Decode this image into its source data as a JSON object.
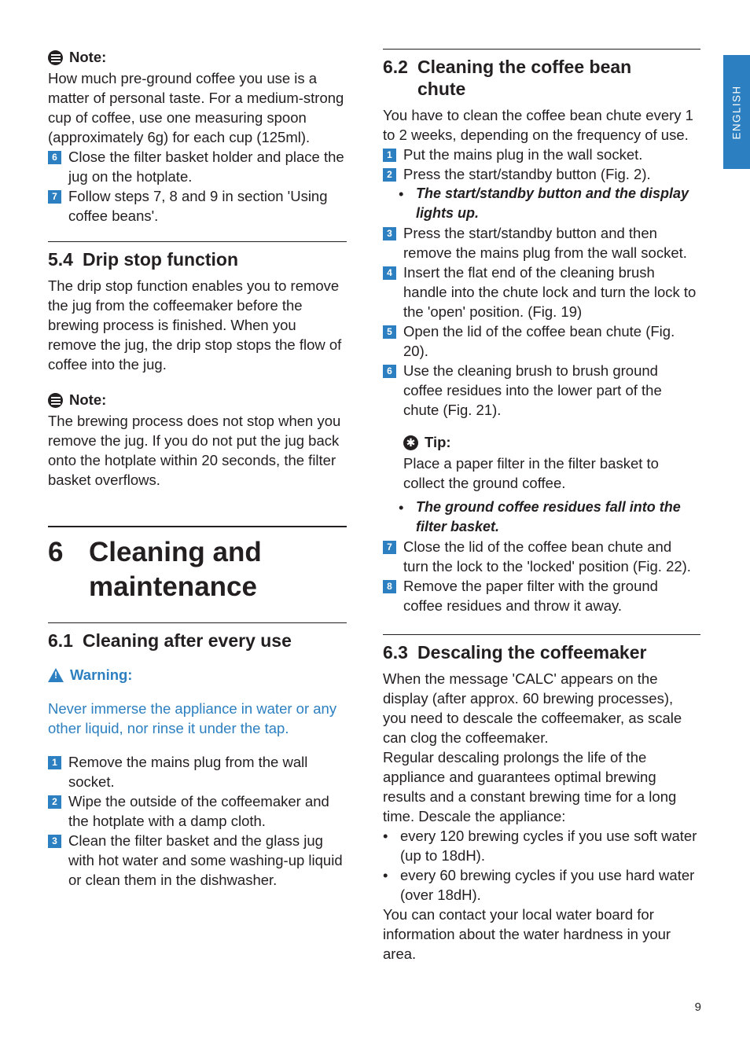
{
  "side_tab": {
    "label": "ENGLISH"
  },
  "page_number": "9",
  "left_column": {
    "note1": {
      "icon": "note-icon",
      "label": "Note:",
      "text": "How much pre-ground coffee you use is a matter of personal taste. For a medium-strong cup of coffee, use one measuring spoon (approximately 6g) for each cup (125ml)."
    },
    "steps_continued": [
      {
        "num": "6",
        "text": "Close the filter basket holder and place the jug on the hotplate."
      },
      {
        "num": "7",
        "text": "Follow steps 7, 8 and 9 in section 'Using coffee beans'."
      }
    ],
    "section_5_4": {
      "number": "5.4",
      "title": "Drip stop function",
      "body": "The drip stop function enables you to remove the jug from the coffeemaker before the brewing process is finished. When you remove the jug, the drip stop stops the flow of coffee into the jug."
    },
    "note2": {
      "icon": "note-icon",
      "label": "Note:",
      "text": "The brewing process does not stop when you remove the jug. If you do not put the jug back onto the hotplate within 20 seconds, the filter basket overflows."
    },
    "chapter_6": {
      "number": "6",
      "title_line1": "Cleaning and",
      "title_line2": "maintenance"
    },
    "section_6_1": {
      "number": "6.1",
      "title": "Cleaning after every use",
      "warning": {
        "icon": "warning-icon",
        "label": "Warning:",
        "text": "Never immerse the appliance in water or any other liquid, nor rinse it under the tap."
      },
      "steps": [
        {
          "num": "1",
          "text": "Remove the mains plug from the wall socket."
        },
        {
          "num": "2",
          "text": "Wipe the outside of the coffeemaker and the hotplate with a damp cloth."
        },
        {
          "num": "3",
          "text": " Clean the filter basket and the glass jug with hot water and some washing-up liquid or clean them in the dishwasher."
        }
      ]
    }
  },
  "right_column": {
    "section_6_2": {
      "number": "6.2",
      "title_line1": "Cleaning the coffee bean",
      "title_line2": "chute",
      "body": "You have to clean the coffee bean chute every 1 to 2 weeks, depending on the frequency of use.",
      "steps_a": [
        {
          "num": "1",
          "text": "Put the mains plug in the wall socket."
        },
        {
          "num": "2",
          "text": "Press the start/standby button (Fig. 2)."
        }
      ],
      "result_1": "The start/standby button and the display lights up.",
      "steps_b": [
        {
          "num": "3",
          "text": "Press the start/standby button and then remove the mains plug from the wall socket."
        },
        {
          "num": "4",
          "text": "Insert the flat end of the cleaning brush handle into the chute lock and turn the lock to the 'open' position.  (Fig. 19)"
        },
        {
          "num": "5",
          "text": "Open the lid of the coffee bean chute (Fig. 20)."
        },
        {
          "num": "6",
          "text": "Use the cleaning brush to brush ground coffee residues into the lower part of the chute (Fig. 21)."
        }
      ],
      "tip": {
        "icon": "tip-icon",
        "label": "Tip:",
        "text": "Place a paper filter in the filter basket to collect the ground coffee."
      },
      "result_2": "The ground coffee residues fall into the filter basket.",
      "steps_c": [
        {
          "num": "7",
          "text": "Close the lid of the coffee bean chute and turn the lock to the 'locked' position (Fig. 22)."
        },
        {
          "num": "8",
          "text": "Remove the paper filter with the ground coffee residues and throw it away."
        }
      ]
    },
    "section_6_3": {
      "number": "6.3",
      "title": "Descaling the coffeemaker",
      "para1": "When the message 'CALC' appears on the display (after approx. 60 brewing processes), you need to descale the coffeemaker, as scale can clog the coffeemaker.",
      "para2": "Regular descaling prolongs the life of the appliance and guarantees optimal brewing results and a constant brewing time for a long time. Descale the appliance:",
      "bullets": [
        "every 120 brewing cycles if you use soft water (up to 18dH).",
        "every 60 brewing cycles if you use hard water (over 18dH)."
      ],
      "para3": "You can contact your local water board for information about the water hardness in your area."
    }
  }
}
